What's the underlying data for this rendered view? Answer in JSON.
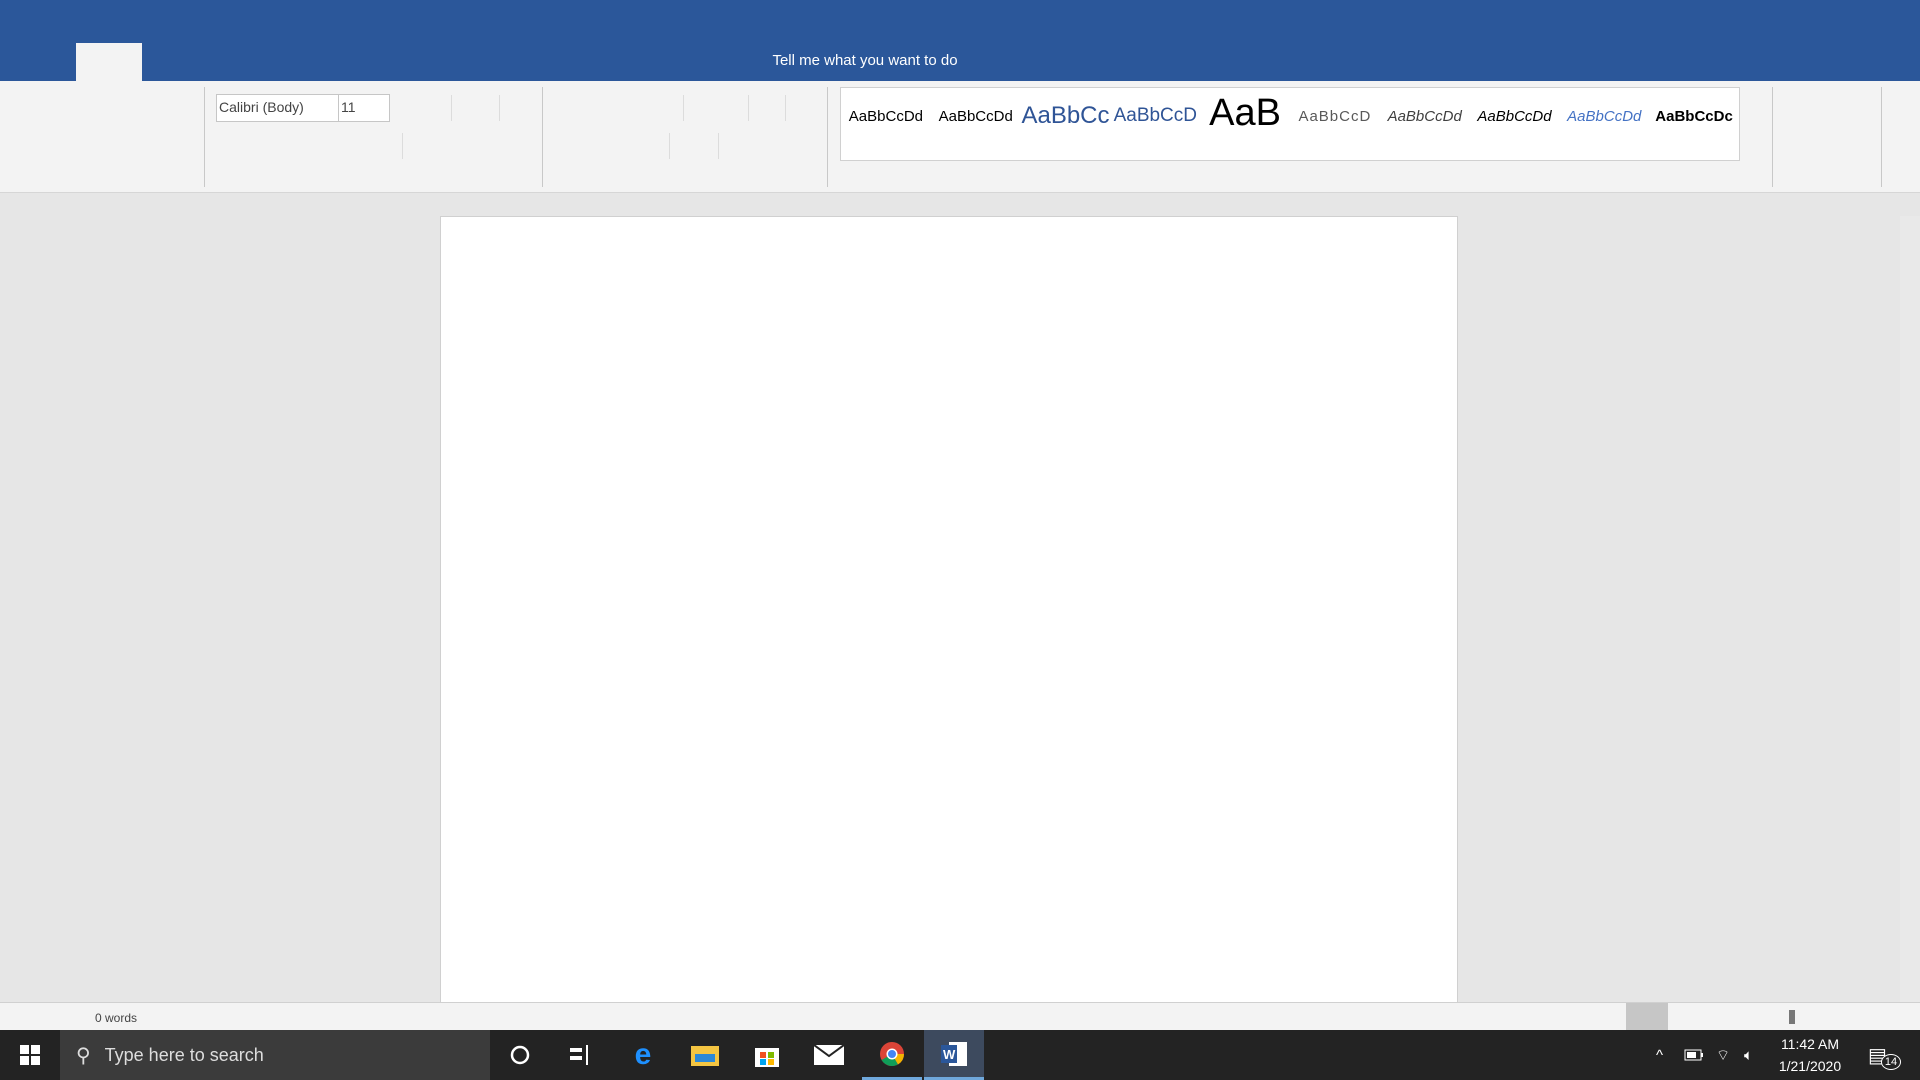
{
  "title_bar": {
    "tell_me": "Tell me what you want to do",
    "accent": "#2B579A"
  },
  "ribbon": {
    "font_name": "Calibri (Body)",
    "font_size": "11",
    "styles": [
      {
        "label": "AaBbCcDd",
        "color": "#000000"
      },
      {
        "label": "AaBbCcDd",
        "color": "#000000"
      },
      {
        "label": "AaBbCc",
        "color": "#2F5496"
      },
      {
        "label": "AaBbCcD",
        "color": "#2F5496"
      },
      {
        "label": "AaB",
        "color": "#000000"
      },
      {
        "label": "AaBbCcD",
        "color": "#595959"
      },
      {
        "label": "AaBbCcDd",
        "color": "#404040"
      },
      {
        "label": "AaBbCcDd",
        "color": "#000000"
      },
      {
        "label": "AaBbCcDd",
        "color": "#4472C4"
      },
      {
        "label": "AaBbCcDc",
        "color": "#000000"
      }
    ]
  },
  "status": {
    "words": "0 words"
  },
  "taskbar": {
    "search_placeholder": "Type here to search",
    "time": "11:42 AM",
    "date": "1/21/2020",
    "notifications": "14",
    "apps": [
      "cortana-icon",
      "task-view-icon",
      "edge-icon",
      "file-explorer-icon",
      "store-icon",
      "mail-icon",
      "chrome-icon",
      "word-icon"
    ]
  }
}
